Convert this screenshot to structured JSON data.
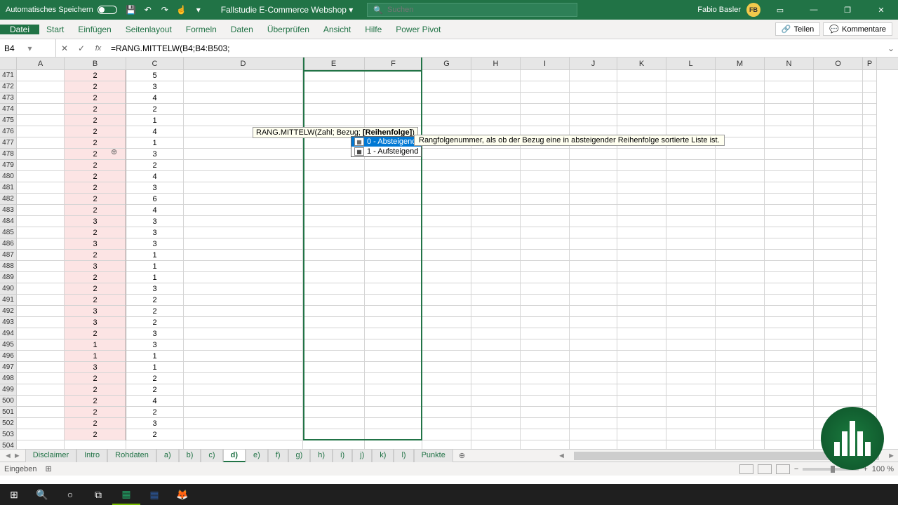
{
  "titlebar": {
    "autosave_label": "Automatisches Speichern",
    "doc_title": "Fallstudie E-Commerce Webshop",
    "search_placeholder": "Suchen",
    "user_name": "Fabio Basler",
    "user_initials": "FB"
  },
  "ribbon": {
    "tabs": [
      "Datei",
      "Start",
      "Einfügen",
      "Seitenlayout",
      "Formeln",
      "Daten",
      "Überprüfen",
      "Ansicht",
      "Hilfe",
      "Power Pivot"
    ],
    "share": "Teilen",
    "comments": "Kommentare"
  },
  "fbar": {
    "namebox": "B4",
    "formula": "=RANG.MITTELW(B4;B4:B503;"
  },
  "columns": [
    "A",
    "B",
    "C",
    "D",
    "E",
    "F",
    "G",
    "H",
    "I",
    "J",
    "K",
    "L",
    "M",
    "N",
    "O",
    "P"
  ],
  "rows": [
    {
      "n": 471,
      "b": "2",
      "c": "5"
    },
    {
      "n": 472,
      "b": "2",
      "c": "3"
    },
    {
      "n": 473,
      "b": "2",
      "c": "4"
    },
    {
      "n": 474,
      "b": "2",
      "c": "2"
    },
    {
      "n": 475,
      "b": "2",
      "c": "1"
    },
    {
      "n": 476,
      "b": "2",
      "c": "4"
    },
    {
      "n": 477,
      "b": "2",
      "c": "1"
    },
    {
      "n": 478,
      "b": "2",
      "c": "3"
    },
    {
      "n": 479,
      "b": "2",
      "c": "2"
    },
    {
      "n": 480,
      "b": "2",
      "c": "4"
    },
    {
      "n": 481,
      "b": "2",
      "c": "3"
    },
    {
      "n": 482,
      "b": "2",
      "c": "6"
    },
    {
      "n": 483,
      "b": "2",
      "c": "4"
    },
    {
      "n": 484,
      "b": "3",
      "c": "3"
    },
    {
      "n": 485,
      "b": "2",
      "c": "3"
    },
    {
      "n": 486,
      "b": "3",
      "c": "3"
    },
    {
      "n": 487,
      "b": "2",
      "c": "1"
    },
    {
      "n": 488,
      "b": "3",
      "c": "1"
    },
    {
      "n": 489,
      "b": "2",
      "c": "1"
    },
    {
      "n": 490,
      "b": "2",
      "c": "3"
    },
    {
      "n": 491,
      "b": "2",
      "c": "2"
    },
    {
      "n": 492,
      "b": "3",
      "c": "2"
    },
    {
      "n": 493,
      "b": "3",
      "c": "2"
    },
    {
      "n": 494,
      "b": "2",
      "c": "3"
    },
    {
      "n": 495,
      "b": "1",
      "c": "3"
    },
    {
      "n": 496,
      "b": "1",
      "c": "1"
    },
    {
      "n": 497,
      "b": "3",
      "c": "1"
    },
    {
      "n": 498,
      "b": "2",
      "c": "2"
    },
    {
      "n": 499,
      "b": "2",
      "c": "2"
    },
    {
      "n": 500,
      "b": "2",
      "c": "4"
    },
    {
      "n": 501,
      "b": "2",
      "c": "2"
    },
    {
      "n": 502,
      "b": "2",
      "c": "3"
    },
    {
      "n": 503,
      "b": "2",
      "c": "2"
    },
    {
      "n": 504,
      "b": "",
      "c": ""
    }
  ],
  "tooltip": {
    "signature_prefix": "RANG.MITTELW(Zahl; Bezug; ",
    "signature_bold": "[Reihenfolge]",
    "signature_suffix": ")",
    "options": [
      {
        "value": "0 - Absteigend"
      },
      {
        "value": "1 - Aufsteigend"
      }
    ],
    "description": "Rangfolgenummer, als ob der Bezug eine in absteigender Reihenfolge sortierte Liste ist."
  },
  "sheets": [
    "Disclaimer",
    "Intro",
    "Rohdaten",
    "a)",
    "b)",
    "c)",
    "d)",
    "e)",
    "f)",
    "g)",
    "h)",
    "i)",
    "j)",
    "k)",
    "l)",
    "Punkte"
  ],
  "active_sheet": "d)",
  "statusbar": {
    "mode": "Eingeben",
    "zoom": "100 %"
  }
}
